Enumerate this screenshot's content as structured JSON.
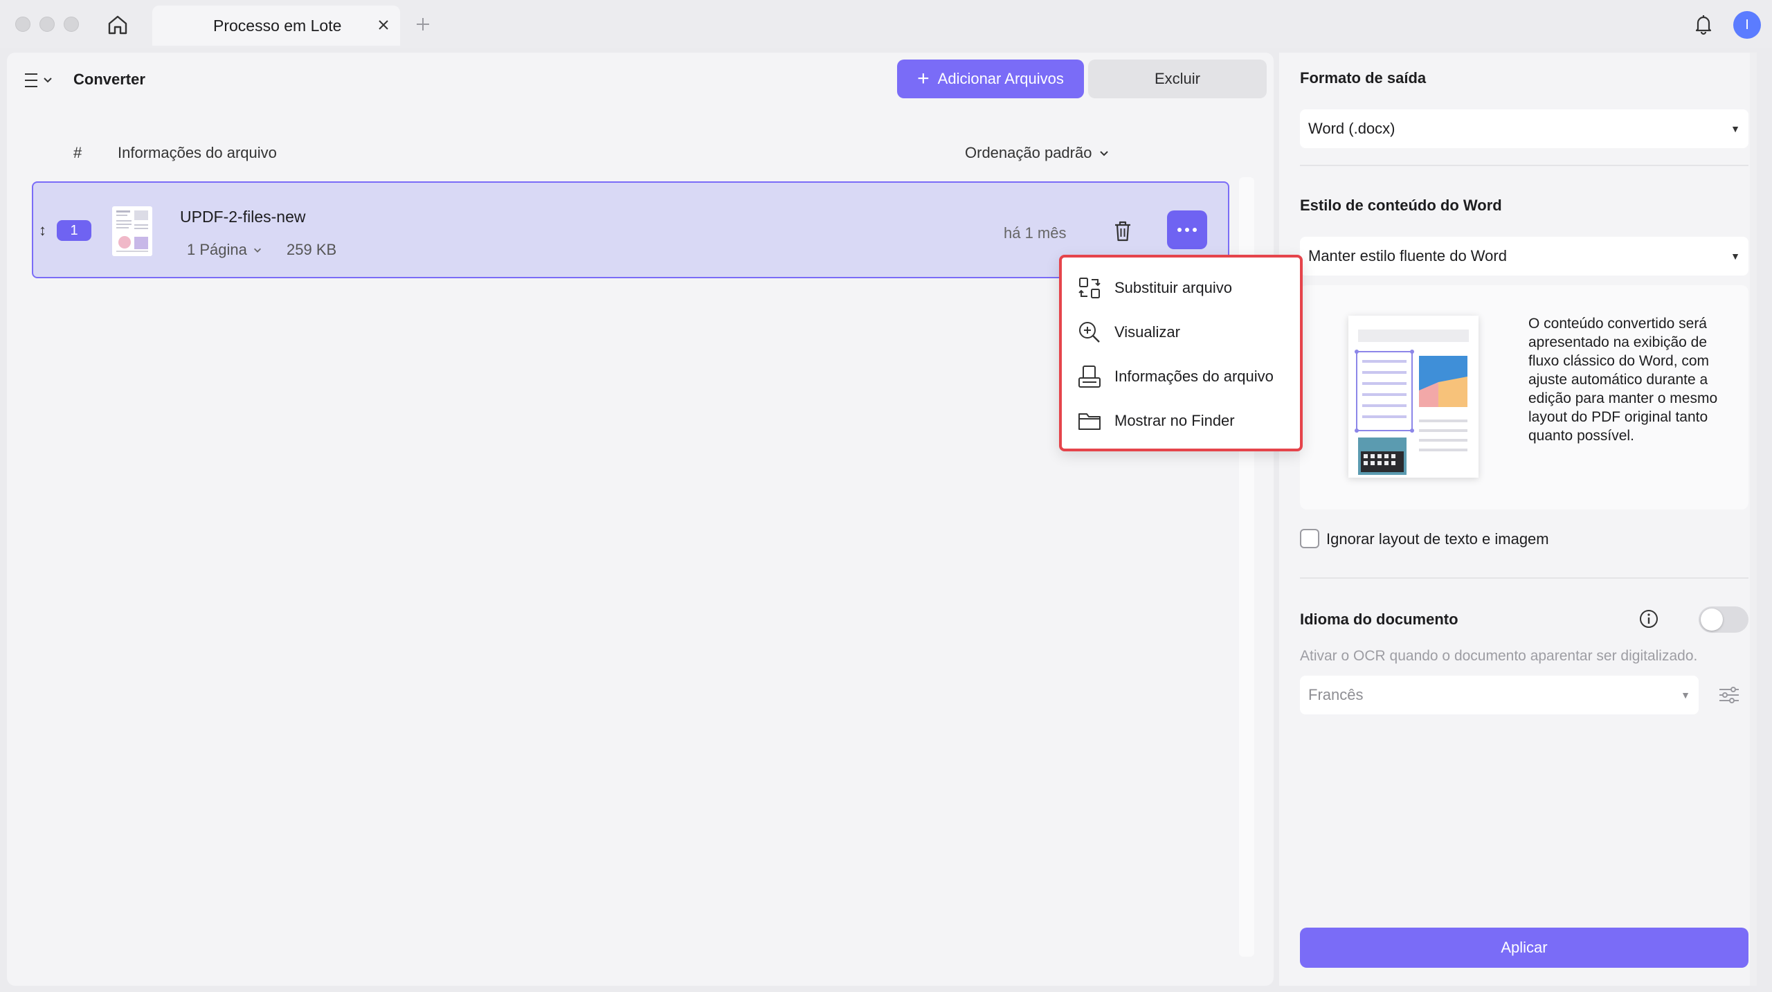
{
  "window": {
    "tab_title": "Processo em Lote",
    "avatar_initial": "I"
  },
  "toolbar": {
    "title": "Converter",
    "add_files_label": "Adicionar Arquivos",
    "add_files_plus": "+",
    "delete_label": "Excluir"
  },
  "file_list": {
    "col_number": "#",
    "col_info": "Informações do arquivo",
    "sort_label": "Ordenação padrão",
    "rows": [
      {
        "index": "1",
        "drag_glyph": "↕",
        "name": "UPDF-2-files-new",
        "pages": "1 Página",
        "size": "259 KB",
        "modified": "há 1 mês"
      }
    ]
  },
  "context_menu": {
    "items": [
      {
        "label": "Substituir arquivo",
        "icon": "replace-icon"
      },
      {
        "label": "Visualizar",
        "icon": "zoom-in-icon"
      },
      {
        "label": "Informações do arquivo",
        "icon": "file-info-icon"
      },
      {
        "label": "Mostrar no Finder",
        "icon": "folder-icon"
      }
    ]
  },
  "settings": {
    "output_format_title": "Formato de saída",
    "output_format_value": "Word (.docx)",
    "word_style_title": "Estilo de conteúdo do Word",
    "word_style_value": "Manter estilo fluente do Word",
    "preview_description": "O conteúdo convertido será apresentado na exibição de fluxo clássico do Word, com ajuste automático durante a edição para manter o mesmo layout do PDF original tanto quanto possível.",
    "ignore_layout_label": "Ignorar layout de texto e imagem",
    "ignore_layout_checked": false,
    "doc_language_title": "Idioma do documento",
    "ocr_toggle_on": false,
    "ocr_hint": "Ativar o OCR quando o documento aparentar ser digitalizado.",
    "language_value": "Francês",
    "apply_label": "Aplicar"
  },
  "colors": {
    "accent": "#7a6cf7",
    "row_highlight": "#d9d9f5",
    "menu_border": "#e5444b"
  }
}
